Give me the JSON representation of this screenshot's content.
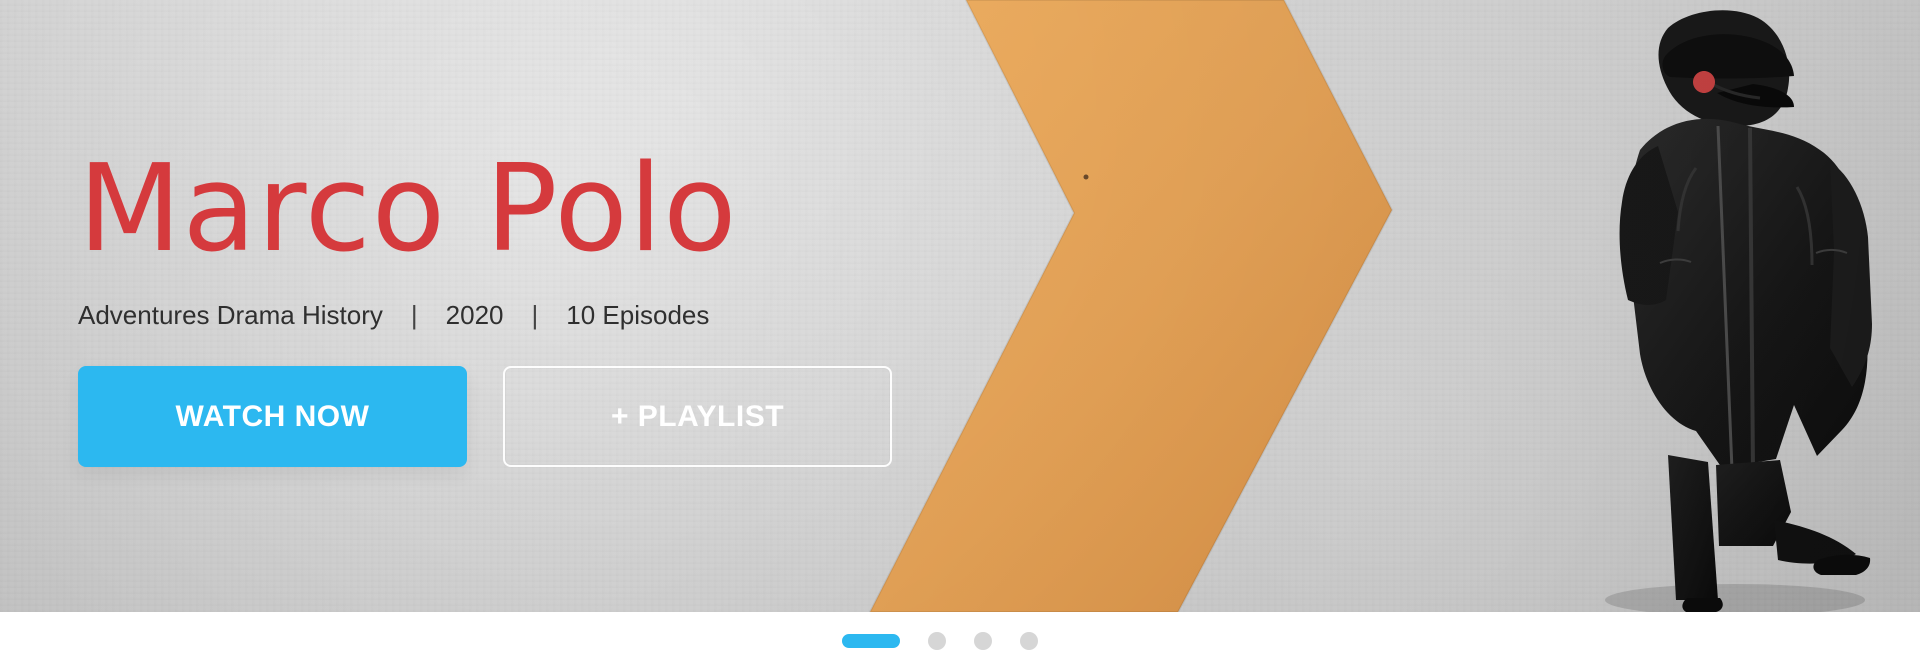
{
  "hero": {
    "title": "Marco Polo",
    "genres": "Adventures Drama History",
    "separator": "|",
    "year": "2020",
    "episodes": "10 Episodes",
    "buttons": {
      "watch_now": "WATCH NOW",
      "playlist": "+ PLAYLIST"
    }
  },
  "slider": {
    "active_index": 0,
    "dots_count": 4
  },
  "colors": {
    "title": "#d53a3d",
    "accent": "#2cb8f0",
    "chevron": "#e7a458",
    "background": "#d1d1d1",
    "inactive_dot": "#d6d6d6"
  }
}
